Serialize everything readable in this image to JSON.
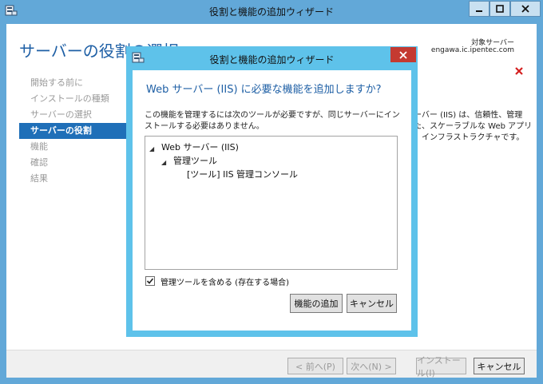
{
  "outer": {
    "title": "役割と機能の追加ウィザード",
    "page_title": "サーバーの役割の選択",
    "target_label": "対象サーバー",
    "target_value": "engawa.ic.ipentec.com",
    "nav": [
      {
        "label": "開始する前に",
        "active": false
      },
      {
        "label": "インストールの種類",
        "active": false
      },
      {
        "label": "サーバーの選択",
        "active": false
      },
      {
        "label": "サーバーの役割",
        "active": true
      },
      {
        "label": "機能",
        "active": false
      },
      {
        "label": "確認",
        "active": false
      },
      {
        "label": "結果",
        "active": false
      }
    ],
    "desc_lines": [
      "ーバー (IIS) は、信頼性、管理",
      "た、スケーラブルな Web アプリ",
      "インフラストラクチャです。"
    ],
    "footer": {
      "prev": "< 前へ(P)",
      "next": "次へ(N) >",
      "install": "インストール(I)",
      "cancel": "キャンセル"
    }
  },
  "modal": {
    "title": "役割と機能の追加ウィザード",
    "heading": "Web サーバー (IIS) に必要な機能を追加しますか?",
    "description": "この機能を管理するには次のツールが必要ですが、同じサーバーにインストールする必要はありません。",
    "tree": {
      "root": "Web サーバー (IIS)",
      "child": "管理ツール",
      "leaf": "[ツール] IIS 管理コンソール"
    },
    "checkbox_label": "管理ツールを含める (存在する場合)",
    "checkbox_checked": true,
    "add_button": "機能の追加",
    "cancel_button": "キャンセル"
  },
  "colors": {
    "accent": "#1e5fa5",
    "nav_active": "#1f6fb8",
    "modal_border": "#5ec2ea",
    "close_red": "#c43a31"
  }
}
